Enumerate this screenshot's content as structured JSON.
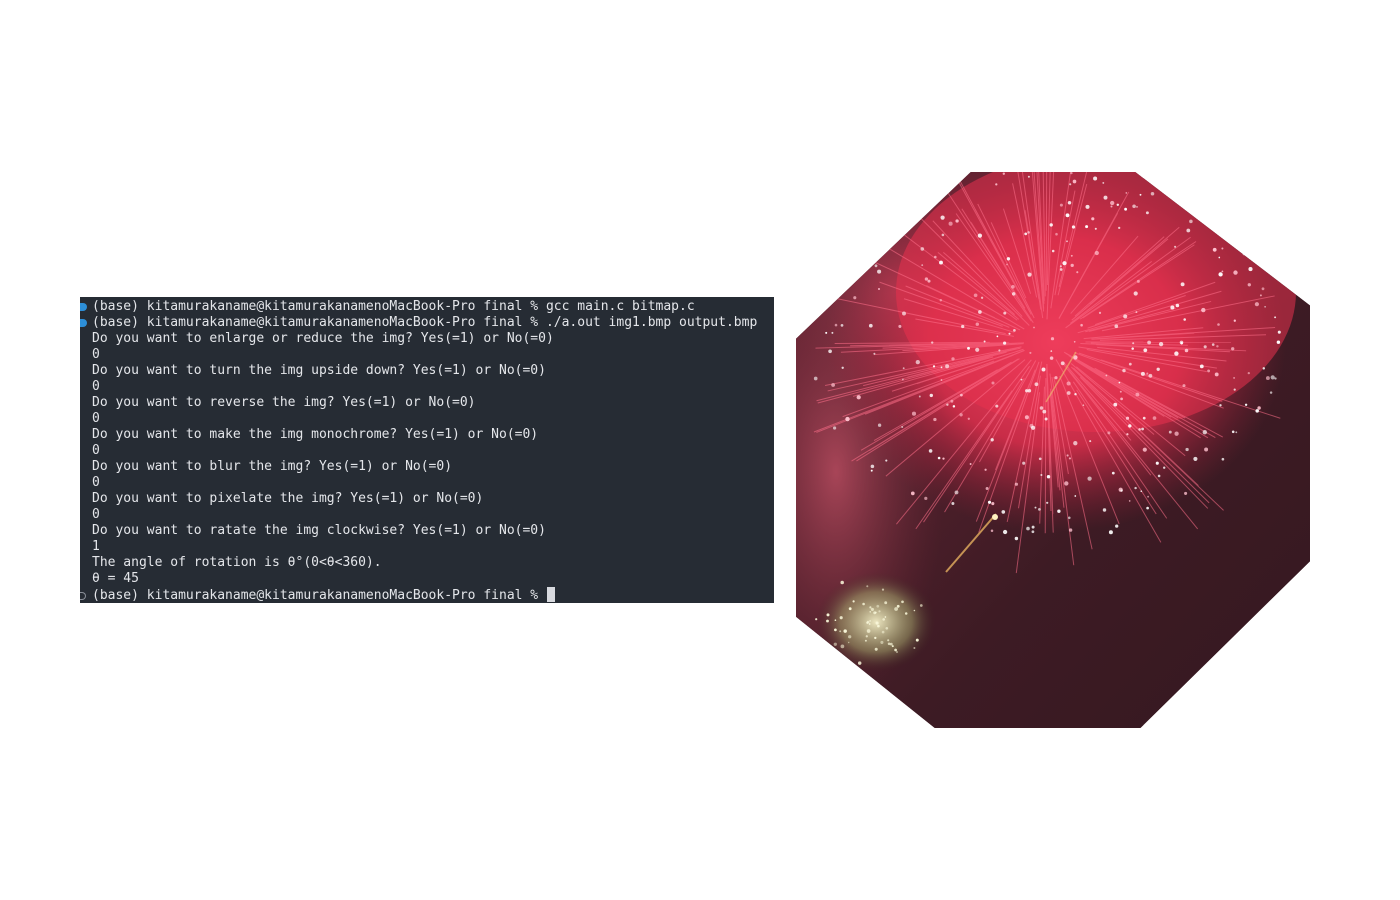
{
  "terminal": {
    "lines": [
      {
        "marker": "filled",
        "text": "(base) kitamurakaname@kitamurakanamenoMacBook-Pro final % gcc main.c bitmap.c"
      },
      {
        "marker": "filled",
        "text": "(base) kitamurakaname@kitamurakanamenoMacBook-Pro final % ./a.out img1.bmp output.bmp"
      },
      {
        "marker": "",
        "text": "Do you want to enlarge or reduce the img? Yes(=1) or No(=0)"
      },
      {
        "marker": "",
        "text": "0"
      },
      {
        "marker": "",
        "text": "Do you want to turn the img upside down? Yes(=1) or No(=0)"
      },
      {
        "marker": "",
        "text": "0"
      },
      {
        "marker": "",
        "text": "Do you want to reverse the img? Yes(=1) or No(=0)"
      },
      {
        "marker": "",
        "text": "0"
      },
      {
        "marker": "",
        "text": "Do you want to make the img monochrome? Yes(=1) or No(=0)"
      },
      {
        "marker": "",
        "text": "0"
      },
      {
        "marker": "",
        "text": "Do you want to blur the img? Yes(=1) or No(=0)"
      },
      {
        "marker": "",
        "text": "0"
      },
      {
        "marker": "",
        "text": "Do you want to pixelate the img? Yes(=1) or No(=0)"
      },
      {
        "marker": "",
        "text": "0"
      },
      {
        "marker": "",
        "text": "Do you want to ratate the img clockwise? Yes(=1) or No(=0)"
      },
      {
        "marker": "",
        "text": "1"
      },
      {
        "marker": "",
        "text": "The angle of rotation is θ°(0<θ<360)."
      },
      {
        "marker": "",
        "text": "θ = 45"
      },
      {
        "marker": "hollow",
        "text": "(base) kitamurakaname@kitamurakanamenoMacBook-Pro final % ",
        "cursor": true
      }
    ],
    "colors": {
      "background": "#262c34",
      "text": "#e4e6ea",
      "marker_active": "#2d8fd8"
    }
  },
  "output_image": {
    "subject": "red fireworks burst over dark night sky with smoke",
    "shape": "octagon"
  }
}
